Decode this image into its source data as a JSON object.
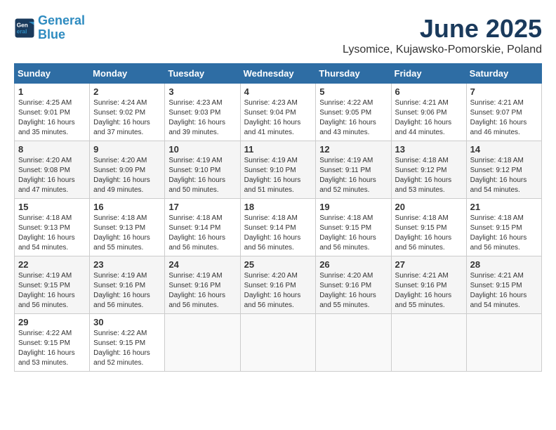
{
  "header": {
    "logo_line1": "General",
    "logo_line2": "Blue",
    "month_title": "June 2025",
    "location": "Lysomice, Kujawsko-Pomorskie, Poland"
  },
  "weekdays": [
    "Sunday",
    "Monday",
    "Tuesday",
    "Wednesday",
    "Thursday",
    "Friday",
    "Saturday"
  ],
  "weeks": [
    [
      {
        "day": "1",
        "sunrise": "4:25 AM",
        "sunset": "9:01 PM",
        "daylight": "16 hours and 35 minutes."
      },
      {
        "day": "2",
        "sunrise": "4:24 AM",
        "sunset": "9:02 PM",
        "daylight": "16 hours and 37 minutes."
      },
      {
        "day": "3",
        "sunrise": "4:23 AM",
        "sunset": "9:03 PM",
        "daylight": "16 hours and 39 minutes."
      },
      {
        "day": "4",
        "sunrise": "4:23 AM",
        "sunset": "9:04 PM",
        "daylight": "16 hours and 41 minutes."
      },
      {
        "day": "5",
        "sunrise": "4:22 AM",
        "sunset": "9:05 PM",
        "daylight": "16 hours and 43 minutes."
      },
      {
        "day": "6",
        "sunrise": "4:21 AM",
        "sunset": "9:06 PM",
        "daylight": "16 hours and 44 minutes."
      },
      {
        "day": "7",
        "sunrise": "4:21 AM",
        "sunset": "9:07 PM",
        "daylight": "16 hours and 46 minutes."
      }
    ],
    [
      {
        "day": "8",
        "sunrise": "4:20 AM",
        "sunset": "9:08 PM",
        "daylight": "16 hours and 47 minutes."
      },
      {
        "day": "9",
        "sunrise": "4:20 AM",
        "sunset": "9:09 PM",
        "daylight": "16 hours and 49 minutes."
      },
      {
        "day": "10",
        "sunrise": "4:19 AM",
        "sunset": "9:10 PM",
        "daylight": "16 hours and 50 minutes."
      },
      {
        "day": "11",
        "sunrise": "4:19 AM",
        "sunset": "9:10 PM",
        "daylight": "16 hours and 51 minutes."
      },
      {
        "day": "12",
        "sunrise": "4:19 AM",
        "sunset": "9:11 PM",
        "daylight": "16 hours and 52 minutes."
      },
      {
        "day": "13",
        "sunrise": "4:18 AM",
        "sunset": "9:12 PM",
        "daylight": "16 hours and 53 minutes."
      },
      {
        "day": "14",
        "sunrise": "4:18 AM",
        "sunset": "9:12 PM",
        "daylight": "16 hours and 54 minutes."
      }
    ],
    [
      {
        "day": "15",
        "sunrise": "4:18 AM",
        "sunset": "9:13 PM",
        "daylight": "16 hours and 54 minutes."
      },
      {
        "day": "16",
        "sunrise": "4:18 AM",
        "sunset": "9:13 PM",
        "daylight": "16 hours and 55 minutes."
      },
      {
        "day": "17",
        "sunrise": "4:18 AM",
        "sunset": "9:14 PM",
        "daylight": "16 hours and 56 minutes."
      },
      {
        "day": "18",
        "sunrise": "4:18 AM",
        "sunset": "9:14 PM",
        "daylight": "16 hours and 56 minutes."
      },
      {
        "day": "19",
        "sunrise": "4:18 AM",
        "sunset": "9:15 PM",
        "daylight": "16 hours and 56 minutes."
      },
      {
        "day": "20",
        "sunrise": "4:18 AM",
        "sunset": "9:15 PM",
        "daylight": "16 hours and 56 minutes."
      },
      {
        "day": "21",
        "sunrise": "4:18 AM",
        "sunset": "9:15 PM",
        "daylight": "16 hours and 56 minutes."
      }
    ],
    [
      {
        "day": "22",
        "sunrise": "4:19 AM",
        "sunset": "9:15 PM",
        "daylight": "16 hours and 56 minutes."
      },
      {
        "day": "23",
        "sunrise": "4:19 AM",
        "sunset": "9:16 PM",
        "daylight": "16 hours and 56 minutes."
      },
      {
        "day": "24",
        "sunrise": "4:19 AM",
        "sunset": "9:16 PM",
        "daylight": "16 hours and 56 minutes."
      },
      {
        "day": "25",
        "sunrise": "4:20 AM",
        "sunset": "9:16 PM",
        "daylight": "16 hours and 56 minutes."
      },
      {
        "day": "26",
        "sunrise": "4:20 AM",
        "sunset": "9:16 PM",
        "daylight": "16 hours and 55 minutes."
      },
      {
        "day": "27",
        "sunrise": "4:21 AM",
        "sunset": "9:16 PM",
        "daylight": "16 hours and 55 minutes."
      },
      {
        "day": "28",
        "sunrise": "4:21 AM",
        "sunset": "9:15 PM",
        "daylight": "16 hours and 54 minutes."
      }
    ],
    [
      {
        "day": "29",
        "sunrise": "4:22 AM",
        "sunset": "9:15 PM",
        "daylight": "16 hours and 53 minutes."
      },
      {
        "day": "30",
        "sunrise": "4:22 AM",
        "sunset": "9:15 PM",
        "daylight": "16 hours and 52 minutes."
      },
      null,
      null,
      null,
      null,
      null
    ]
  ],
  "labels": {
    "sunrise_prefix": "Sunrise: ",
    "sunset_prefix": "Sunset: ",
    "daylight_prefix": "Daylight: "
  }
}
